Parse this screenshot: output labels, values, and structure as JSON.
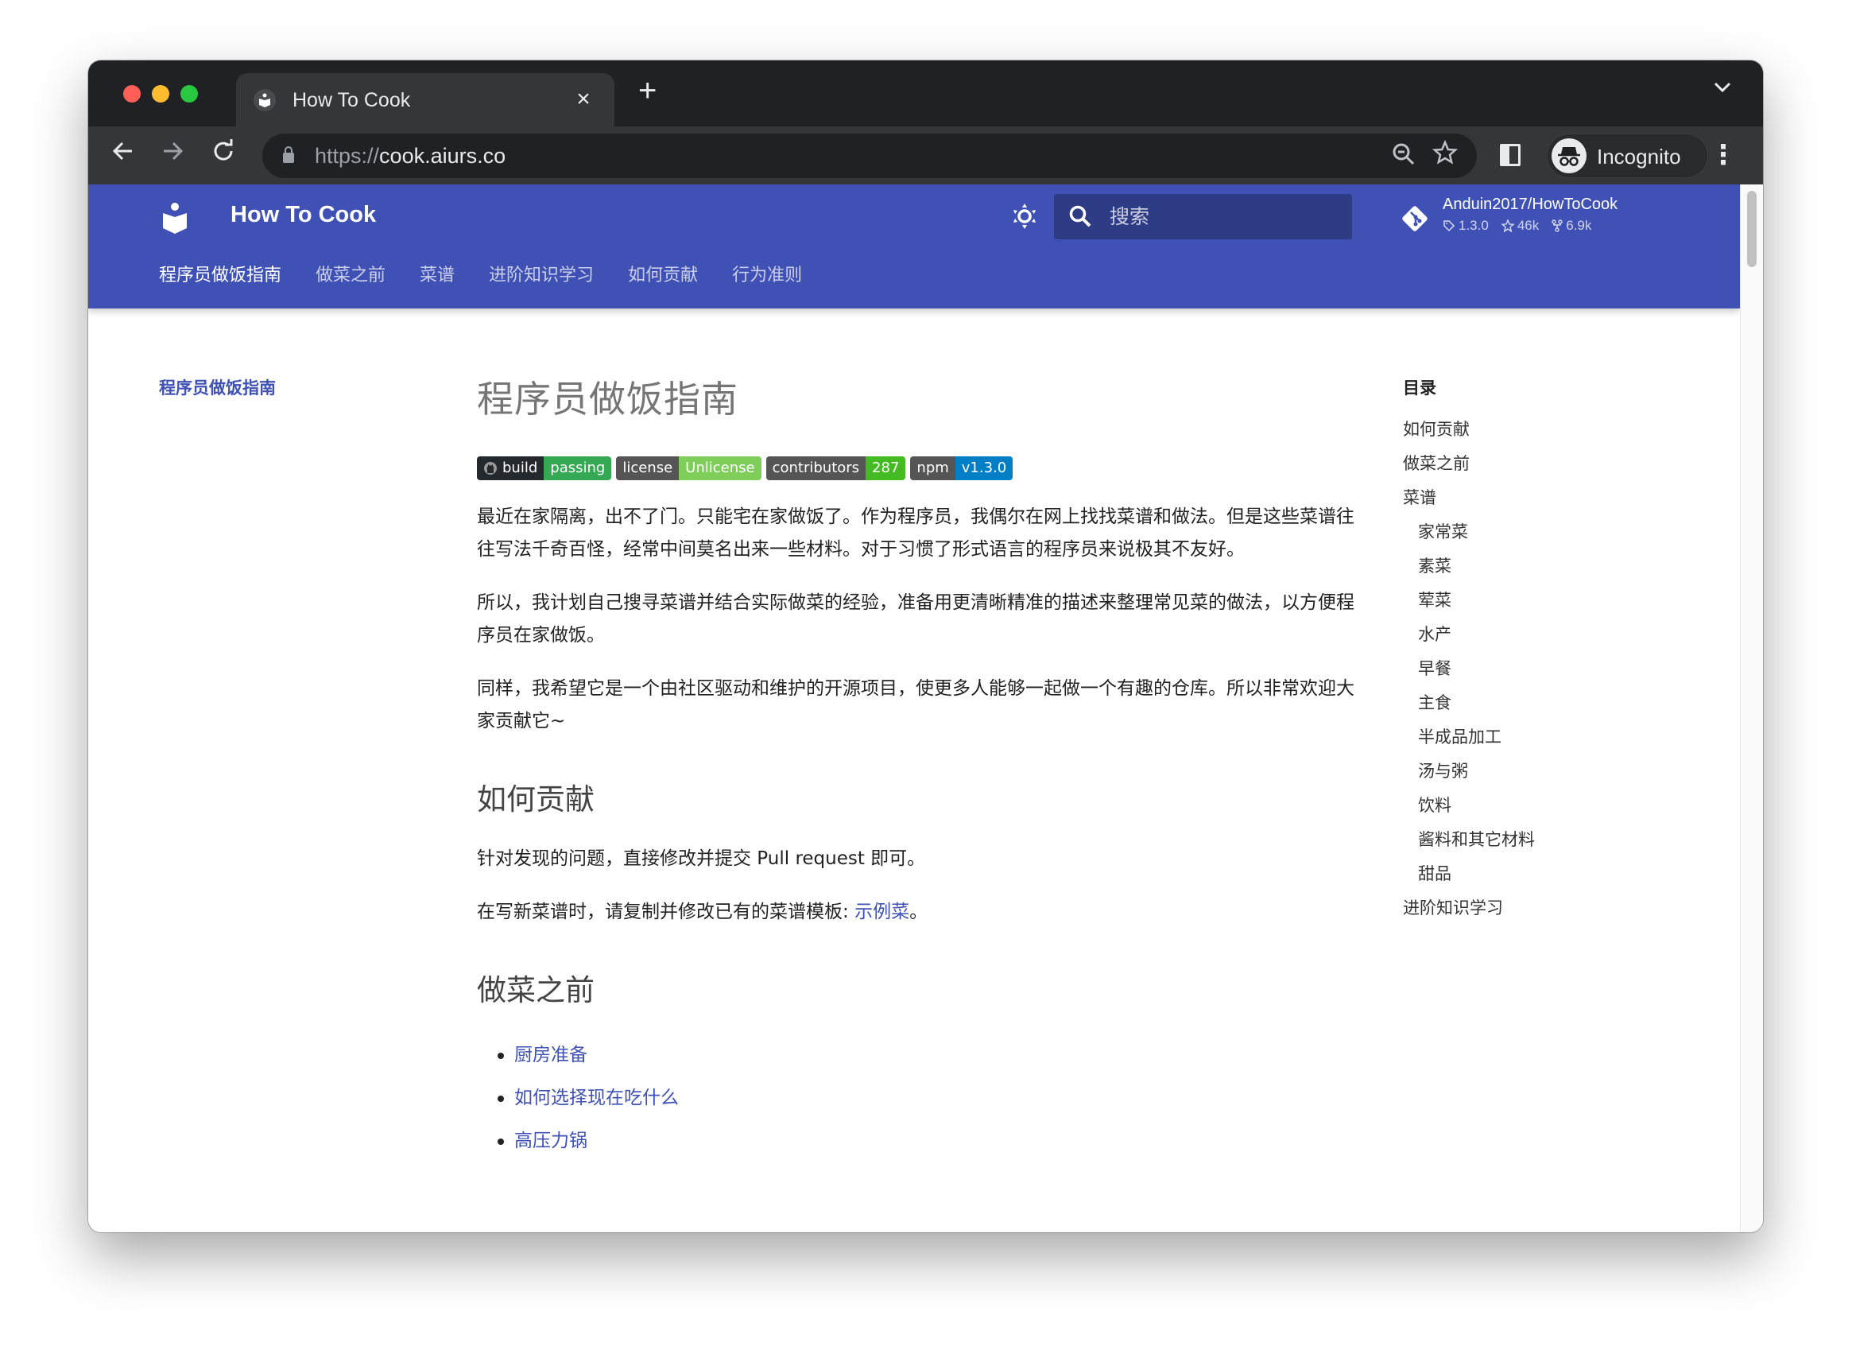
{
  "browser": {
    "tab": {
      "title": "How To Cook",
      "close": "×"
    },
    "new_tab": "+",
    "tab_search": "⌄",
    "url": {
      "scheme": "https://",
      "host": "cook.aiurs.co"
    },
    "profile_label": "Incognito",
    "icons": {
      "back": "←",
      "forward": "→",
      "reload": "↻",
      "zoom": "zoom-out-icon",
      "star": "☆",
      "menu": "⋮"
    }
  },
  "site": {
    "title": "How To Cook",
    "search_placeholder": "搜索",
    "repo": {
      "name": "Anduin2017/HowToCook",
      "version": "1.3.0",
      "stars": "46k",
      "forks": "6.9k"
    },
    "nav_tabs": [
      {
        "label": "程序员做饭指南",
        "active": true
      },
      {
        "label": "做菜之前"
      },
      {
        "label": "菜谱"
      },
      {
        "label": "进阶知识学习"
      },
      {
        "label": "如何贡献"
      },
      {
        "label": "行为准则"
      }
    ]
  },
  "sidebar": {
    "items": [
      {
        "label": "程序员做饭指南",
        "active": true
      }
    ]
  },
  "main": {
    "title": "程序员做饭指南",
    "badges": [
      {
        "left": "build",
        "right": "passing",
        "color": "#4c1",
        "left_color": "#24292e",
        "icon": "github-icon"
      },
      {
        "left": "license",
        "right": "Unlicense",
        "color": "#7fce5a"
      },
      {
        "left": "contributors",
        "right": "287",
        "color": "#44bb22"
      },
      {
        "left": "npm",
        "right": "v1.3.0",
        "color": "#007ec6"
      }
    ],
    "intro": [
      "最近在家隔离，出不了门。只能宅在家做饭了。作为程序员，我偶尔在网上找找菜谱和做法。但是这些菜谱往往写法千奇百怪，经常中间莫名出来一些材料。对于习惯了形式语言的程序员来说极其不友好。",
      "所以，我计划自己搜寻菜谱并结合实际做菜的经验，准备用更清晰精准的描述来整理常见菜的做法，以方便程序员在家做饭。",
      "同样，我希望它是一个由社区驱动和维护的开源项目，使更多人能够一起做一个有趣的仓库。所以非常欢迎大家贡献它~"
    ],
    "contribute": {
      "heading": "如何贡献",
      "p1": "针对发现的问题，直接修改并提交 Pull request 即可。",
      "p2_prefix": "在写新菜谱时，请复制并修改已有的菜谱模板: ",
      "p2_link": "示例菜",
      "p2_suffix": "。"
    },
    "before_cooking": {
      "heading": "做菜之前",
      "links": [
        "厨房准备",
        "如何选择现在吃什么",
        "高压力锅"
      ]
    }
  },
  "toc": {
    "title": "目录",
    "items": [
      {
        "label": "如何贡献",
        "level": 1
      },
      {
        "label": "做菜之前",
        "level": 1
      },
      {
        "label": "菜谱",
        "level": 1
      },
      {
        "label": "家常菜",
        "level": 2
      },
      {
        "label": "素菜",
        "level": 2
      },
      {
        "label": "荤菜",
        "level": 2
      },
      {
        "label": "水产",
        "level": 2
      },
      {
        "label": "早餐",
        "level": 2
      },
      {
        "label": "主食",
        "level": 2
      },
      {
        "label": "半成品加工",
        "level": 2
      },
      {
        "label": "汤与粥",
        "level": 2
      },
      {
        "label": "饮料",
        "level": 2
      },
      {
        "label": "酱料和其它材料",
        "level": 2
      },
      {
        "label": "甜品",
        "level": 2
      },
      {
        "label": "进阶知识学习",
        "level": 1
      }
    ]
  },
  "colors": {
    "primary": "#3f51b5",
    "chrome_dark": "#202124",
    "chrome_toolbar": "#35363a"
  }
}
